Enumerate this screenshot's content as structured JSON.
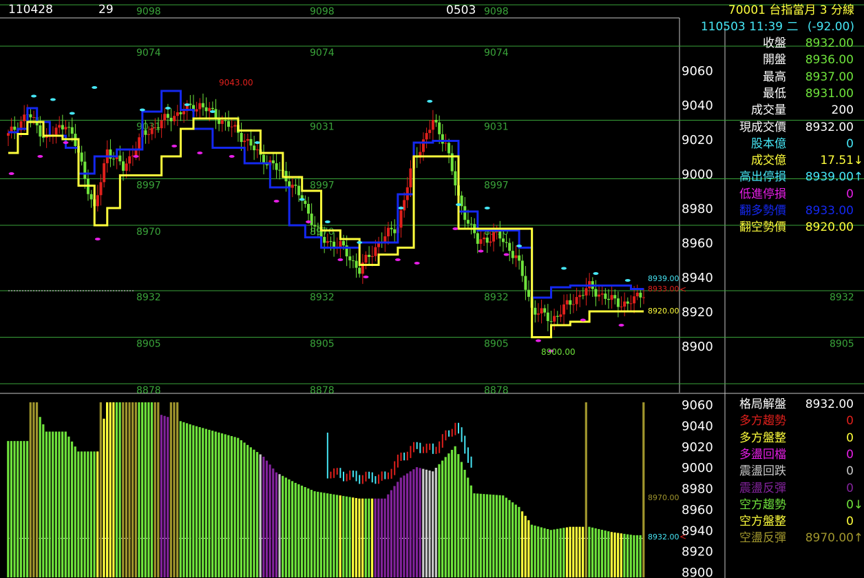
{
  "header": {
    "date": "110428",
    "count": "29",
    "time_mark": "0503",
    "product": "70001 台指當月 3 分線",
    "datetime": "110503 11:39 二",
    "change": "(-92.00)"
  },
  "colors": {
    "background": "#000000",
    "up_bar": "#e0201c",
    "down_bar": "#6fe33c",
    "blue_line": "#1428f0",
    "yellow_line": "#ffff3c",
    "grid_green": "#3aa43a",
    "cyan": "#46e6f5",
    "magenta": "#e61ee6",
    "olive": "#a0962d",
    "purple": "#82239b",
    "silver": "#c8c8c8"
  },
  "quote_panel": [
    {
      "label": "收盤",
      "value": "8932.00",
      "label_color": "#ffffff",
      "value_color": "#6fe33c"
    },
    {
      "label": "開盤",
      "value": "8936.00",
      "label_color": "#ffffff",
      "value_color": "#6fe33c"
    },
    {
      "label": "最高",
      "value": "8937.00",
      "label_color": "#ffffff",
      "value_color": "#6fe33c"
    },
    {
      "label": "最低",
      "value": "8931.00",
      "label_color": "#ffffff",
      "value_color": "#6fe33c"
    },
    {
      "label": "成交量",
      "value": "200",
      "label_color": "#ffffff",
      "value_color": "#ffffff"
    },
    {
      "label": "現成交價",
      "value": "8932.00",
      "label_color": "#ffffff",
      "value_color": "#ffffff"
    },
    {
      "label": "股本億",
      "value": "0",
      "label_color": "#46e6f5",
      "value_color": "#46e6f5"
    },
    {
      "label": "成交億",
      "value": "17.51",
      "label_color": "#ffff3c",
      "value_color": "#ffff3c",
      "arrow": "↓",
      "arrow_color": "#ffff3c"
    },
    {
      "label": "高出停損",
      "value": "8939.00",
      "label_color": "#46e6f5",
      "value_color": "#46e6f5",
      "arrow": "↑",
      "arrow_color": "#46e6f5"
    },
    {
      "label": "低進停損",
      "value": "0",
      "label_color": "#e61ee6",
      "value_color": "#e61ee6"
    },
    {
      "label": "翻多勢價",
      "value": "8933.00",
      "label_color": "#1428f0",
      "value_color": "#1428f0"
    },
    {
      "label": "翻空勢價",
      "value": "8920.00",
      "label_color": "#ffff3c",
      "value_color": "#ffff3c"
    }
  ],
  "pattern_panel": [
    {
      "label": "格局解盤",
      "value": "8932.00",
      "label_color": "#ffffff",
      "value_color": "#ffffff"
    },
    {
      "label": "多方趨勢",
      "value": "0",
      "label_color": "#e0201c",
      "value_color": "#e0201c"
    },
    {
      "label": "多方盤整",
      "value": "0",
      "label_color": "#ffff3c",
      "value_color": "#ffff3c"
    },
    {
      "label": "多盪回檔",
      "value": "0",
      "label_color": "#e61ee6",
      "value_color": "#e61ee6"
    },
    {
      "label": "震盪回跌",
      "value": "0",
      "label_color": "#c8c8c8",
      "value_color": "#c8c8c8"
    },
    {
      "label": "震盪反彈",
      "value": "0",
      "label_color": "#82239b",
      "value_color": "#82239b"
    },
    {
      "label": "空方趨勢",
      "value": "0",
      "label_color": "#6fe33c",
      "value_color": "#6fe33c",
      "arrow": "↓",
      "arrow_color": "#6fe33c"
    },
    {
      "label": "空方盤整",
      "value": "0",
      "label_color": "#ffff3c",
      "value_color": "#ffff3c"
    },
    {
      "label": "空盪反彈",
      "value": "8970.00",
      "label_color": "#a0962d",
      "value_color": "#a0962d",
      "arrow": "↑",
      "arrow_color": "#a0962d"
    }
  ],
  "chart_data": [
    {
      "type": "candlestick",
      "title": "",
      "ylim": [
        8880,
        9080
      ],
      "y_ticks": [
        9060,
        9040,
        9020,
        9000,
        8980,
        8960,
        8940,
        8920,
        8900
      ],
      "grid_levels": [
        9098,
        9074,
        9031,
        8997,
        8970,
        8932,
        8905,
        8878
      ],
      "grid_label_sets": [
        {
          "label": "9098",
          "columns": 3
        },
        {
          "label": "9074",
          "columns": 3
        },
        {
          "label": "9031",
          "columns": 3
        },
        {
          "label": "8997",
          "columns": 3
        },
        {
          "label": "8970",
          "columns": 3
        },
        {
          "label": "8932",
          "columns": 4
        },
        {
          "label": "8905",
          "columns": 4
        },
        {
          "label": "8878",
          "columns": 3
        }
      ],
      "annotations": [
        {
          "text": "9043.00",
          "price": 9043,
          "color": "#e0201c"
        },
        {
          "text": "8900.00",
          "price": 8900,
          "color": "#6fe33c"
        },
        {
          "text": "8939.00",
          "price": 8939,
          "color": "#46e6f5"
        },
        {
          "text": "8933.00",
          "price": 8933,
          "color": "#e0201c"
        },
        {
          "text": "8920.00",
          "price": 8920,
          "color": "#ffff3c"
        }
      ],
      "anchors": [
        [
          0,
          9022
        ],
        [
          6,
          9035
        ],
        [
          12,
          9020
        ],
        [
          18,
          9030
        ],
        [
          22,
          9012
        ],
        [
          27,
          8978
        ],
        [
          31,
          9014
        ],
        [
          36,
          9003
        ],
        [
          42,
          9022
        ],
        [
          48,
          9030
        ],
        [
          54,
          9036
        ],
        [
          60,
          9040
        ],
        [
          66,
          9032
        ],
        [
          72,
          9024
        ],
        [
          79,
          9010
        ],
        [
          86,
          9000
        ],
        [
          92,
          8985
        ],
        [
          98,
          8962
        ],
        [
          104,
          8958
        ],
        [
          110,
          8944
        ],
        [
          116,
          8960
        ],
        [
          122,
          8970
        ],
        [
          127,
          9008
        ],
        [
          133,
          9030
        ],
        [
          137,
          9018
        ],
        [
          141,
          8985
        ],
        [
          147,
          8960
        ],
        [
          153,
          8965
        ],
        [
          159,
          8952
        ],
        [
          164,
          8922
        ],
        [
          170,
          8915
        ],
        [
          176,
          8925
        ],
        [
          182,
          8934
        ],
        [
          188,
          8927
        ],
        [
          194,
          8924
        ],
        [
          200,
          8933
        ]
      ],
      "blue_steps": [
        [
          0,
          9024
        ],
        [
          3,
          9026
        ],
        [
          6,
          9038
        ],
        [
          9,
          9030
        ],
        [
          13,
          9022
        ],
        [
          18,
          9015
        ],
        [
          22,
          9000
        ],
        [
          27,
          9010
        ],
        [
          34,
          9014
        ],
        [
          42,
          9036
        ],
        [
          48,
          9048
        ],
        [
          54,
          9037
        ],
        [
          58,
          9026
        ],
        [
          64,
          9015
        ],
        [
          74,
          9006
        ],
        [
          82,
          8992
        ],
        [
          88,
          8970
        ],
        [
          93,
          8963
        ],
        [
          98,
          8957
        ],
        [
          110,
          8960
        ],
        [
          122,
          8988
        ],
        [
          127,
          9018
        ],
        [
          133,
          9019
        ],
        [
          137,
          9019
        ],
        [
          141,
          8978
        ],
        [
          147,
          8967
        ],
        [
          160,
          8957
        ],
        [
          164,
          8928
        ],
        [
          170,
          8934
        ],
        [
          176,
          8935
        ],
        [
          182,
          8935
        ],
        [
          195,
          8933
        ]
      ],
      "yellow_steps": [
        [
          0,
          9012
        ],
        [
          3,
          9023
        ],
        [
          6,
          9030
        ],
        [
          11,
          9022
        ],
        [
          17,
          9020
        ],
        [
          22,
          8993
        ],
        [
          27,
          8970
        ],
        [
          31,
          8980
        ],
        [
          35,
          8999
        ],
        [
          48,
          9010
        ],
        [
          54,
          9026
        ],
        [
          58,
          9032
        ],
        [
          66,
          9032
        ],
        [
          72,
          9025
        ],
        [
          79,
          9012
        ],
        [
          86,
          8998
        ],
        [
          92,
          8990
        ],
        [
          98,
          8967
        ],
        [
          104,
          8962
        ],
        [
          110,
          8947
        ],
        [
          116,
          8953
        ],
        [
          122,
          8957
        ],
        [
          127,
          9010
        ],
        [
          137,
          9010
        ],
        [
          141,
          8968
        ],
        [
          156,
          8968
        ],
        [
          164,
          8905
        ],
        [
          170,
          8912
        ],
        [
          176,
          8914
        ],
        [
          182,
          8920
        ],
        [
          188,
          8920
        ],
        [
          196,
          8920
        ]
      ],
      "cyan_markers": [
        [
          8,
          9045
        ],
        [
          14,
          9043
        ],
        [
          20,
          9035
        ],
        [
          27,
          9050
        ],
        [
          42,
          9037
        ],
        [
          50,
          9038
        ],
        [
          56,
          9040
        ],
        [
          64,
          9036
        ],
        [
          78,
          9018
        ],
        [
          92,
          8985
        ],
        [
          100,
          8972
        ],
        [
          110,
          8960
        ],
        [
          123,
          8980
        ],
        [
          132,
          9042
        ],
        [
          141,
          8982
        ],
        [
          150,
          8980
        ],
        [
          160,
          8958
        ],
        [
          174,
          8945
        ],
        [
          184,
          8942
        ],
        [
          194,
          8938
        ]
      ],
      "magenta_markers": [
        [
          1,
          9000
        ],
        [
          10,
          9010
        ],
        [
          18,
          9018
        ],
        [
          28,
          8962
        ],
        [
          40,
          9010
        ],
        [
          52,
          9016
        ],
        [
          60,
          9012
        ],
        [
          70,
          9010
        ],
        [
          84,
          8984
        ],
        [
          94,
          8972
        ],
        [
          104,
          8950
        ],
        [
          112,
          8940
        ],
        [
          122,
          8950
        ],
        [
          128,
          8948
        ],
        [
          140,
          8968
        ],
        [
          148,
          8955
        ],
        [
          156,
          8953
        ],
        [
          166,
          8903
        ],
        [
          170,
          8897
        ],
        [
          180,
          8915
        ],
        [
          192,
          8912
        ]
      ]
    },
    {
      "type": "bar",
      "title": "",
      "ylim": [
        8900,
        9070
      ],
      "y_ticks": [
        9060,
        9040,
        9020,
        9000,
        8980,
        8960,
        8940,
        8920,
        8900
      ],
      "annotations": [
        {
          "text": "8970.00",
          "price": 8970,
          "color": "#a0962d"
        },
        {
          "text": "8932.00",
          "price": 8932,
          "color": "#46e6f5"
        }
      ],
      "bar_heights": [
        [
          0,
          9025
        ],
        [
          6,
          9025
        ],
        [
          8,
          9062
        ],
        [
          12,
          9034
        ],
        [
          18,
          9034
        ],
        [
          22,
          9015
        ],
        [
          28,
          9015
        ],
        [
          31,
          9062
        ],
        [
          45,
          9062
        ],
        [
          48,
          9050
        ],
        [
          58,
          9040
        ],
        [
          72,
          9028
        ],
        [
          80,
          9010
        ],
        [
          84,
          8995
        ],
        [
          90,
          8985
        ],
        [
          96,
          8977
        ],
        [
          104,
          8973
        ],
        [
          110,
          8970
        ],
        [
          118,
          8970
        ],
        [
          123,
          8990
        ],
        [
          128,
          9000
        ],
        [
          133,
          8996
        ],
        [
          140,
          9020
        ],
        [
          146,
          8975
        ],
        [
          155,
          8973
        ],
        [
          160,
          8962
        ],
        [
          164,
          8945
        ],
        [
          170,
          8940
        ],
        [
          176,
          8943
        ],
        [
          182,
          8943
        ],
        [
          189,
          8938
        ],
        [
          196,
          8935
        ]
      ],
      "color_segments": [
        {
          "from": 0,
          "to": 6,
          "color": "#6fe33c"
        },
        {
          "from": 7,
          "to": 9,
          "color": "#a0962d"
        },
        {
          "from": 10,
          "to": 27,
          "color": "#6fe33c"
        },
        {
          "from": 28,
          "to": 28,
          "color": "#ffff3c"
        },
        {
          "from": 29,
          "to": 29,
          "color": "#a0962d"
        },
        {
          "from": 30,
          "to": 33,
          "color": "#ffff3c"
        },
        {
          "from": 34,
          "to": 35,
          "color": "#6fe33c"
        },
        {
          "from": 36,
          "to": 40,
          "color": "#a0962d"
        },
        {
          "from": 41,
          "to": 45,
          "color": "#6fe33c"
        },
        {
          "from": 46,
          "to": 47,
          "color": "#a0962d"
        },
        {
          "from": 48,
          "to": 50,
          "color": "#82239b"
        },
        {
          "from": 51,
          "to": 53,
          "color": "#a0962d"
        },
        {
          "from": 54,
          "to": 78,
          "color": "#6fe33c"
        },
        {
          "from": 79,
          "to": 79,
          "color": "#c8c8c8"
        },
        {
          "from": 80,
          "to": 84,
          "color": "#82239b"
        },
        {
          "from": 85,
          "to": 85,
          "color": "#c8c8c8"
        },
        {
          "from": 86,
          "to": 103,
          "color": "#6fe33c"
        },
        {
          "from": 104,
          "to": 104,
          "color": "#ffff3c"
        },
        {
          "from": 105,
          "to": 107,
          "color": "#6fe33c"
        },
        {
          "from": 108,
          "to": 111,
          "color": "#ffff3c"
        },
        {
          "from": 112,
          "to": 113,
          "color": "#6fe33c"
        },
        {
          "from": 114,
          "to": 114,
          "color": "#ffff3c"
        },
        {
          "from": 115,
          "to": 129,
          "color": "#82239b"
        },
        {
          "from": 130,
          "to": 134,
          "color": "#c8c8c8"
        },
        {
          "from": 135,
          "to": 141,
          "color": "#6fe33c"
        },
        {
          "from": 142,
          "to": 145,
          "color": "#6fe33c"
        },
        {
          "from": 146,
          "to": 160,
          "color": "#6fe33c"
        },
        {
          "from": 161,
          "to": 163,
          "color": "#ffff3c"
        },
        {
          "from": 164,
          "to": 174,
          "color": "#6fe33c"
        },
        {
          "from": 175,
          "to": 180,
          "color": "#ffff3c"
        },
        {
          "from": 181,
          "to": 181,
          "color": "#a0962d"
        },
        {
          "from": 182,
          "to": 188,
          "color": "#6fe33c"
        },
        {
          "from": 189,
          "to": 192,
          "color": "#ffff3c"
        },
        {
          "from": 193,
          "to": 198,
          "color": "#6fe33c"
        },
        {
          "from": 199,
          "to": 199,
          "color": "#a0962d"
        }
      ],
      "tall_olive": [
        7,
        8,
        9,
        29,
        36,
        37,
        38,
        39,
        40,
        46,
        47,
        51,
        52,
        53,
        181,
        199
      ]
    }
  ]
}
